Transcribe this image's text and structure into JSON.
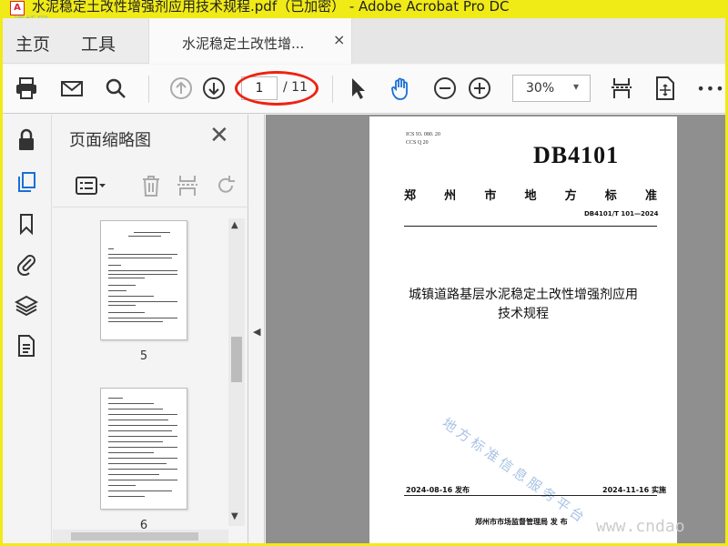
{
  "window": {
    "title": "水泥稳定土改性增强剂应用技术规程.pdf（已加密） - Adobe Acrobat Pro DC",
    "watermark_top_left": "道桥网",
    "watermark_bottom_right": "www.cndao"
  },
  "menu": {
    "home": "主页",
    "tools": "工具"
  },
  "tab": {
    "label": "水泥稳定土改性增...",
    "close": "×"
  },
  "toolbar": {
    "page_current": "1",
    "page_total": "/ 11",
    "zoom": "30%",
    "zoom_arrow": "▾",
    "more": "•••"
  },
  "panel": {
    "title": "页面缩略图",
    "close": "✕",
    "thumb_labels": [
      "5",
      "6"
    ]
  },
  "document": {
    "ics_line1": "ICS  93. 080. 20",
    "ics_line2": "CCS  Q 20",
    "db_code": "DB4101",
    "standard_chars": [
      "郑",
      "州",
      "市",
      "地",
      "方",
      "标",
      "准"
    ],
    "standard_number": "DB4101/T 101—2024",
    "title_line1": "城镇道路基层水泥稳定土改性增强剂应用",
    "title_line2": "技术规程",
    "watermark": "地方标准信息服务平台",
    "publish_date": "2024-08-16 发布",
    "implement_date": "2024-11-16 实施",
    "issuer": "郑州市市场监督管理局    发  布"
  },
  "colors": {
    "accent_red": "#e21a1a",
    "frame_yellow": "#f0ea17",
    "doc_bg": "#8f8f8f"
  }
}
